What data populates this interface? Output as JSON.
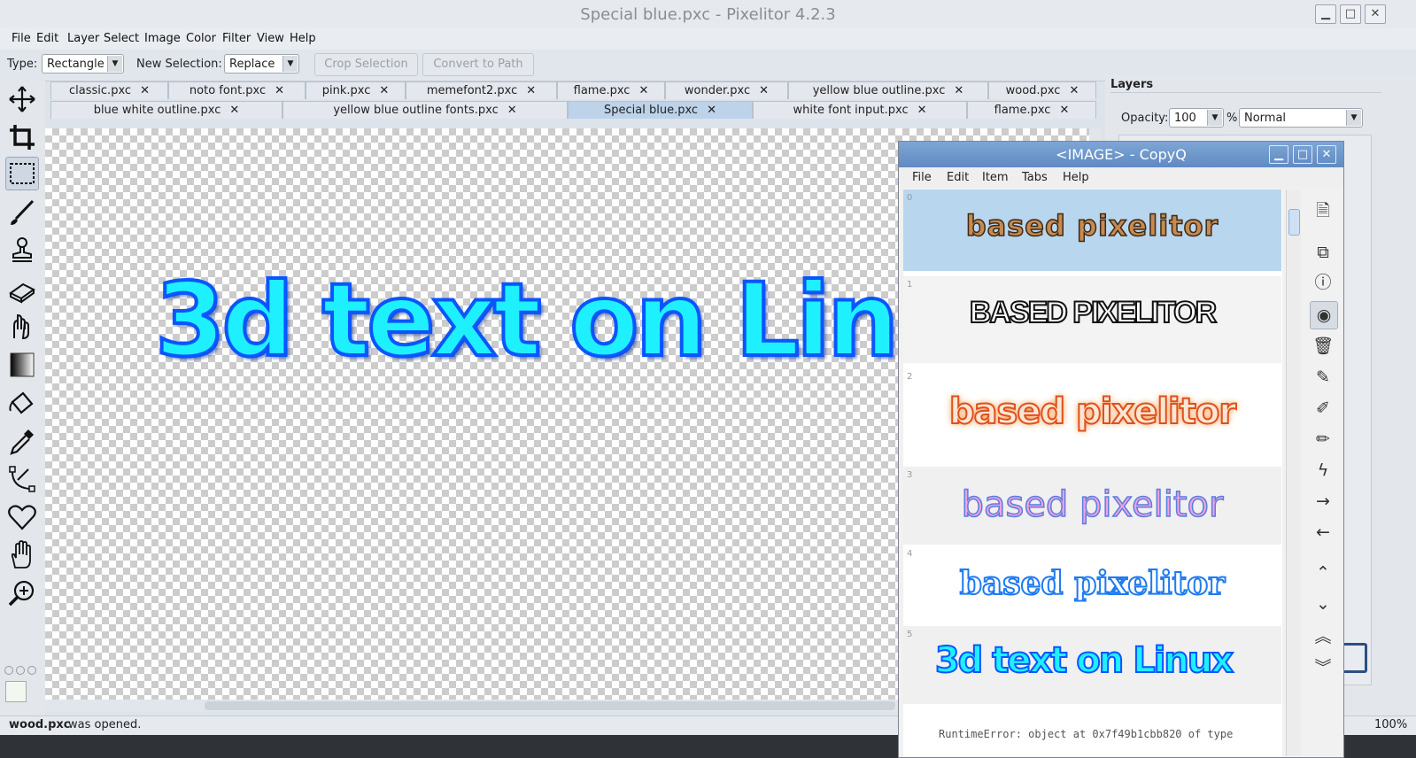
{
  "window": {
    "title": "Special blue.pxc - Pixelitor 4.2.3",
    "minimize": "▁",
    "maximize": "□",
    "close": "✕"
  },
  "menu": [
    "File",
    "Edit",
    "Layer",
    "Select",
    "Image",
    "Color",
    "Filter",
    "View",
    "Help"
  ],
  "toolbar": {
    "type_label": "Type:",
    "type_value": "Rectangle",
    "new_selection_label": "New Selection:",
    "new_selection_value": "Replace",
    "crop_selection": "Crop Selection",
    "convert_to_path": "Convert to Path"
  },
  "tabs_row1": [
    "classic.pxc",
    "noto font.pxc",
    "pink.pxc",
    "memefont2.pxc",
    "flame.pxc",
    "wonder.pxc",
    "yellow blue outline.pxc",
    "wood.pxc"
  ],
  "tabs_row2": [
    "blue white outline.pxc",
    "yellow blue outline fonts.pxc",
    "Special blue.pxc",
    "white font input.pxc",
    "flame.pxc"
  ],
  "tab_close": "✕",
  "canvas": {
    "text": "3d text on Linux"
  },
  "layers": {
    "heading": "Layers",
    "opacity_label": "Opacity:",
    "opacity_value": "100",
    "percent": "%",
    "blend_mode": "Normal"
  },
  "status": {
    "file": "wood.pxc",
    "message": " was opened.",
    "zoom": "100%"
  },
  "copyq": {
    "title": "<IMAGE> - CopyQ",
    "menu": [
      "File",
      "Edit",
      "Item",
      "Tabs",
      "Help"
    ],
    "items": [
      {
        "index": "0",
        "text": "based pixelitor"
      },
      {
        "index": "1",
        "text": "BASED PIXELITOR"
      },
      {
        "index": "2",
        "text": "based pixelitor"
      },
      {
        "index": "3",
        "text": "based pixelitor"
      },
      {
        "index": "4",
        "text": "based pixelitor"
      },
      {
        "index": "5",
        "text": "3d text on Linux"
      }
    ],
    "footer_text": "RuntimeError: object at 0x7f49b1cbb820 of type"
  },
  "colors": {
    "accent": "#0a55ff",
    "text_fill": "#1ff0ff",
    "selected_item": "#b8d6ee"
  }
}
